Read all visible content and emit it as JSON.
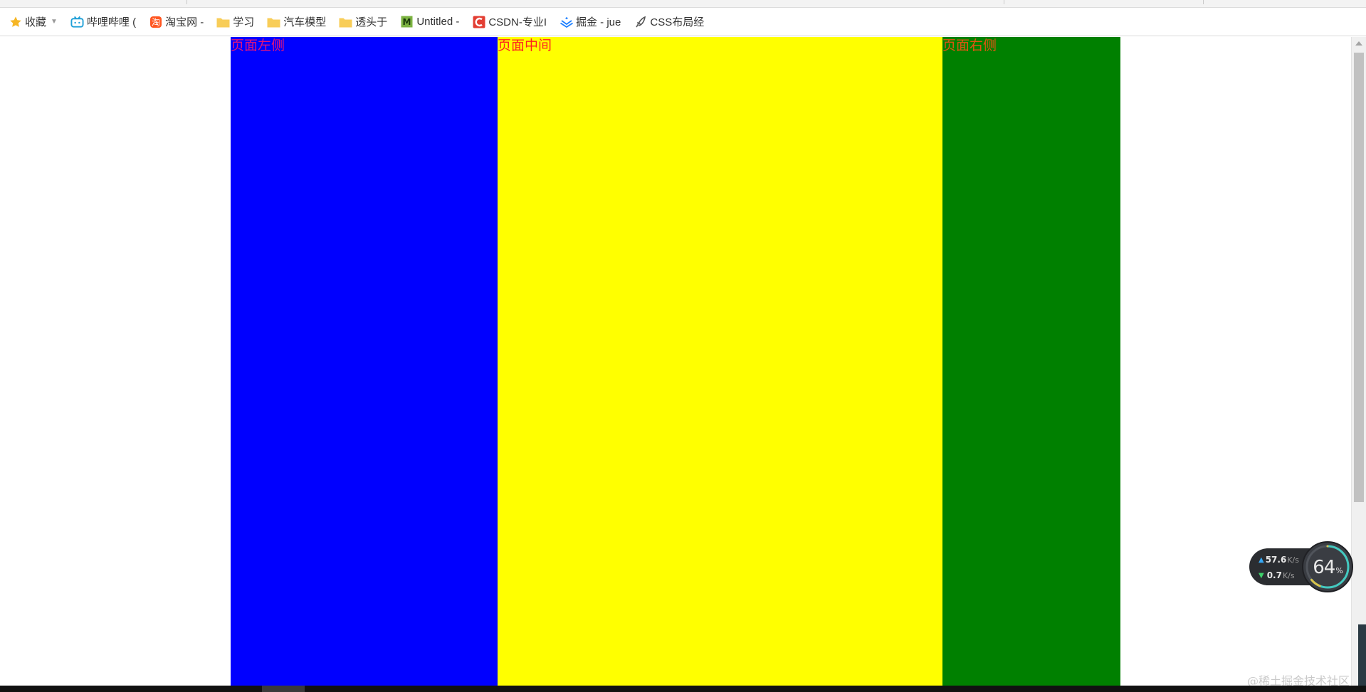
{
  "bookmarks": [
    {
      "label": "收藏",
      "icon": "star-icon",
      "has_caret": true
    },
    {
      "label": "哔哩哔哩 (",
      "icon": "bilibili-icon"
    },
    {
      "label": "淘宝网 -",
      "icon": "taobao-icon"
    },
    {
      "label": "学习",
      "icon": "folder-icon"
    },
    {
      "label": "汽车模型",
      "icon": "folder-icon"
    },
    {
      "label": "透头于",
      "icon": "folder-icon"
    },
    {
      "label": "Untitled -",
      "icon": "m-logo-icon"
    },
    {
      "label": "CSDN-专业I",
      "icon": "csdn-icon"
    },
    {
      "label": "掘金 - jue",
      "icon": "juejin-icon"
    },
    {
      "label": "CSS布局经",
      "icon": "css-leaf-icon"
    }
  ],
  "page": {
    "left": {
      "label": "页面左侧",
      "bg": "#0000ff"
    },
    "center": {
      "label": "页面中间",
      "bg": "#ffff00"
    },
    "right": {
      "label": "页面右侧",
      "bg": "#008000"
    }
  },
  "net_widget": {
    "upload_value": "57.6",
    "upload_unit": "K/s",
    "download_value": "0.7",
    "download_unit": "K/s",
    "percent": "64",
    "percent_unit": "%",
    "percent_fraction": 0.64
  },
  "watermark": "@稀土掘金技术社区"
}
